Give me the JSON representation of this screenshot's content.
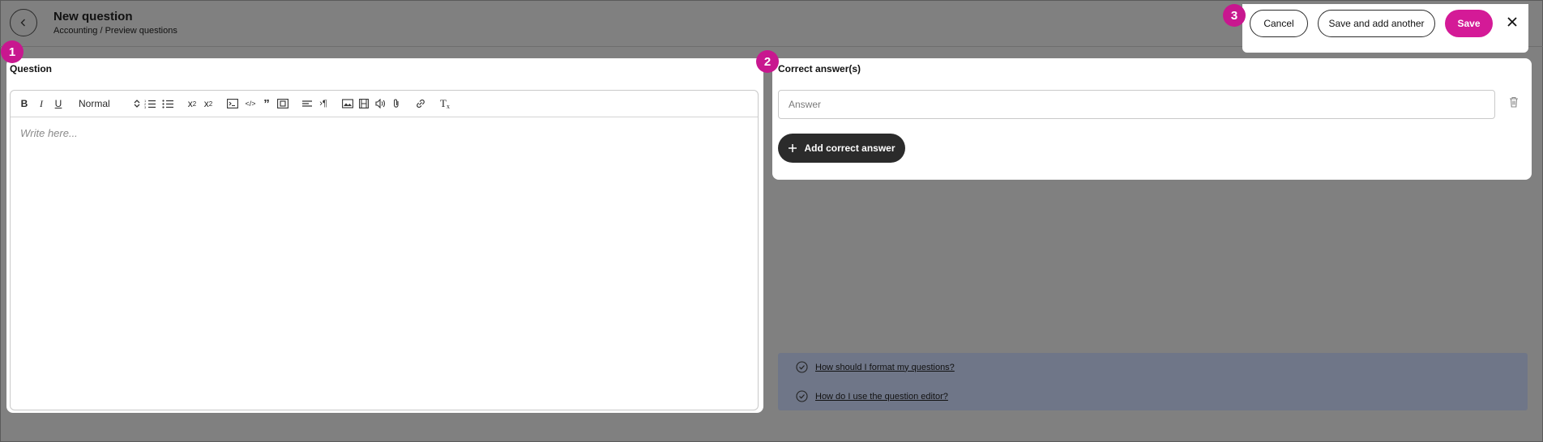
{
  "header": {
    "title": "New question",
    "breadcrumb": "Accounting / Preview questions"
  },
  "badges": [
    "1",
    "2",
    "3"
  ],
  "question_panel": {
    "title": "Question",
    "format_select": "Normal",
    "placeholder": "Write here..."
  },
  "answers_panel": {
    "title": "Correct answer(s)",
    "answer_placeholder": "Answer",
    "add_label": "Add correct answer"
  },
  "actions": {
    "cancel": "Cancel",
    "save_and_add": "Save and add another",
    "save": "Save"
  },
  "help": [
    "How should I format my questions?",
    "How do I use the question editor?"
  ],
  "colors": {
    "accent": "#d41a97",
    "badge": "#c8178f",
    "overlay": "#808080",
    "help_bg": "#6f7688"
  }
}
